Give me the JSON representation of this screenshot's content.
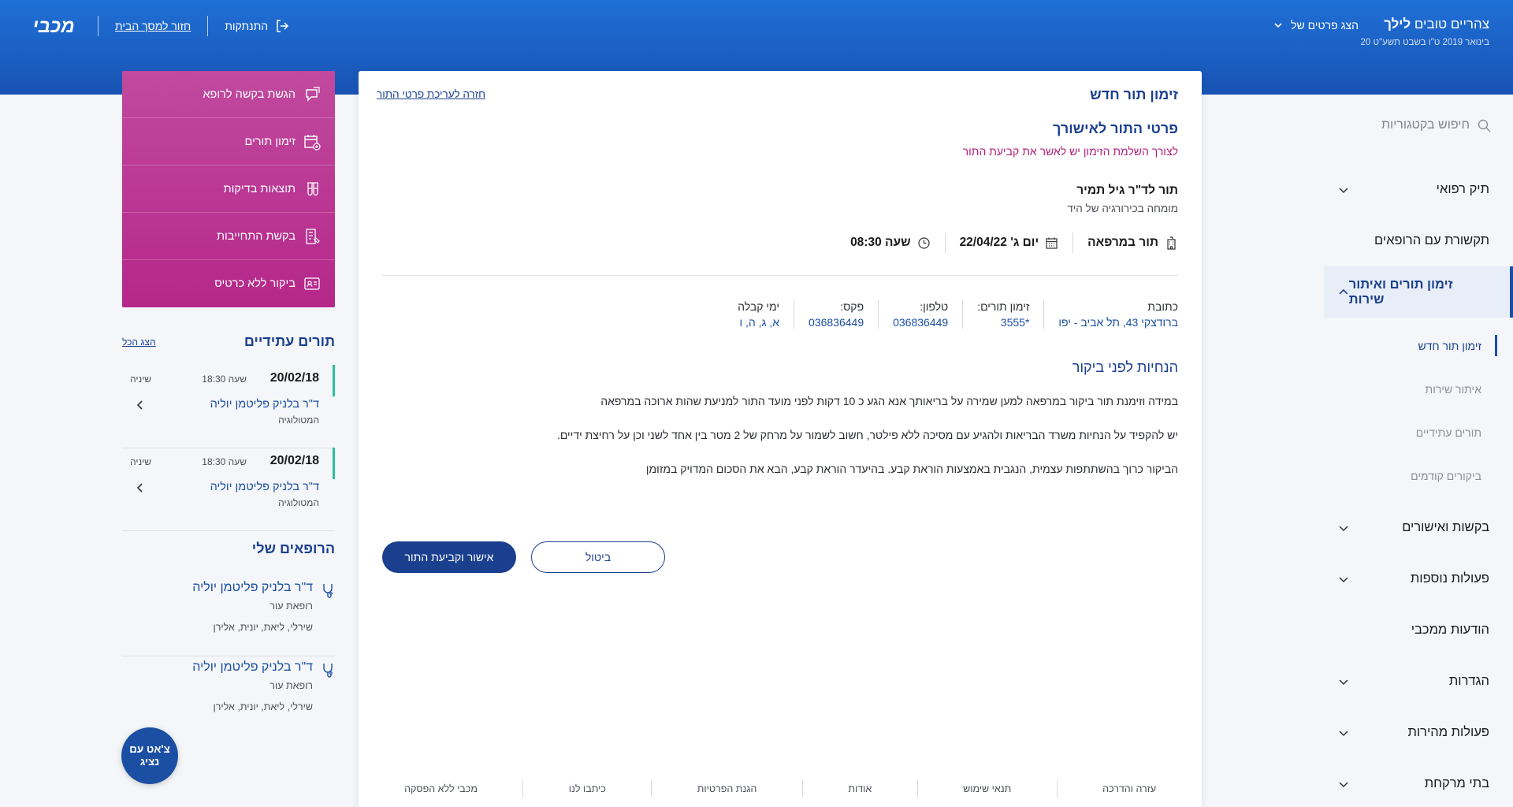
{
  "header": {
    "greeting_prefix": "צהריים טובים",
    "greeting_name": "לילך",
    "date": "20 בינואר 2019 ט\"ו בשבט תשע\"ט",
    "show_details_label": "הצג פרטים של",
    "home_link": "חזור למסך הבית",
    "logout_label": "התנתקות",
    "logo_text": "מכבי"
  },
  "sidebar": {
    "search_placeholder": "חיפוש בקטגוריות",
    "items": [
      {
        "label": "תיק רפואי",
        "has_chevron": true
      },
      {
        "label": "תקשורת עם הרופאים",
        "has_chevron": false
      },
      {
        "label": "זימון תורים ואיתור שירות",
        "has_chevron": true,
        "expanded": true
      },
      {
        "label": "בקשות ואישורים",
        "has_chevron": true
      },
      {
        "label": "פעולות נוספות",
        "has_chevron": true
      },
      {
        "label": "הודעות ממכבי",
        "has_chevron": false
      },
      {
        "label": "הגדרות",
        "has_chevron": true
      },
      {
        "label": "פעולות מהירות",
        "has_chevron": true
      },
      {
        "label": "בתי מרקחת",
        "has_chevron": true
      }
    ],
    "sub_items": [
      "זימון תור חדש",
      "איתור שירות",
      "תורים עתידיים",
      "ביקורים קודמים"
    ]
  },
  "main": {
    "page_title": "זימון תור חדש",
    "back_link": "חזרה לעריכת פרטי התור",
    "section_title": "פרטי התור לאישורך",
    "section_note": "לצורך השלמת הזימון יש לאשר את קביעת התור",
    "doctor_line": "תור לד\"ר גיל תמיר",
    "doctor_specialty": "מומחה בכירורגיה של היד",
    "appointment": {
      "type": "תור במרפאה",
      "date": "יום ג' 22/04/22",
      "time": "שעה 08:30"
    },
    "clinic_info": [
      {
        "label": "כתובת",
        "value": "ברודצקי 43, תל אביב - יפו"
      },
      {
        "label": "זימון תורים:",
        "value": "*3555"
      },
      {
        "label": "טלפון:",
        "value": "036836449"
      },
      {
        "label": "פקס:",
        "value": "036836449"
      },
      {
        "label": "ימי קבלה",
        "value": "א, ג, ה, ו"
      }
    ],
    "guidelines_title": "הנחיות לפני ביקור",
    "guidelines": [
      "במידה וזימנת תור ביקור במרפאה למען שמירה על בריאותך אנא הגע כ 10 דקות לפני מועד התור למניעת שהות ארוכה במרפאה",
      "יש להקפיד על הנחיות משרד הבריאות ולהגיע עם מסיכה ללא פילטר, חשוב לשמור על מרחק של 2 מטר בין אחד לשני וכן על רחיצת ידיים.",
      "הביקור כרוך בהשתתפות עצמית, הנגבית באמצעות הוראת קבע. בהיעדר הוראת קבע, הבא את הסכום המדויק במזומן"
    ],
    "confirm_button": "אישור וקביעת התור",
    "cancel_button": "ביטול",
    "footer_links": [
      "עזרה והדרכה",
      "תנאי שימוש",
      "אודות",
      "הגנת הפרטיות",
      "כיתבו לנו",
      "מכבי ללא הפסקה"
    ]
  },
  "quick_actions": [
    {
      "label": "הגשת בקשה לרופא",
      "icon": "chat-bubble-icon"
    },
    {
      "label": "זימון תורים",
      "icon": "calendar-add-icon"
    },
    {
      "label": "תוצאות בדיקות",
      "icon": "test-tubes-icon"
    },
    {
      "label": "בקשת התחייבות",
      "icon": "document-list-icon"
    },
    {
      "label": "ביקור ללא כרטיס",
      "icon": "id-card-icon"
    }
  ],
  "upcoming": {
    "title": "תורים עתידיים",
    "show_all": "הצג הכל",
    "appointments": [
      {
        "date": "20/02/18",
        "time": "שעה 18:30",
        "type": "שיניה",
        "doctor": "ד\"ר בלניק פליטמן יוליה",
        "specialty": "המטולוגיה"
      },
      {
        "date": "20/02/18",
        "time": "שעה 18:30",
        "type": "שיניה",
        "doctor": "ד\"ר בלניק פליטמן יוליה",
        "specialty": "המטולוגיה"
      }
    ]
  },
  "my_doctors": {
    "title": "הרופאים שלי",
    "doctors": [
      {
        "name": "ד\"ר בלניק פליטמן יוליה",
        "role": "רופאת עור",
        "team": "שירלי, ליאת, יונית, אלירן"
      },
      {
        "name": "ד\"ר בלניק פליטמן יוליה",
        "role": "רופאת עור",
        "team": "שירלי, ליאת, יונית, אלירן"
      }
    ]
  },
  "chat_button": "צ'אט עם נציג",
  "colors": {
    "header_blue": "#1f6fd6",
    "primary_navy": "#1b3f8f",
    "magenta": "#b5278a",
    "teal_bar": "#2bbf9e"
  }
}
